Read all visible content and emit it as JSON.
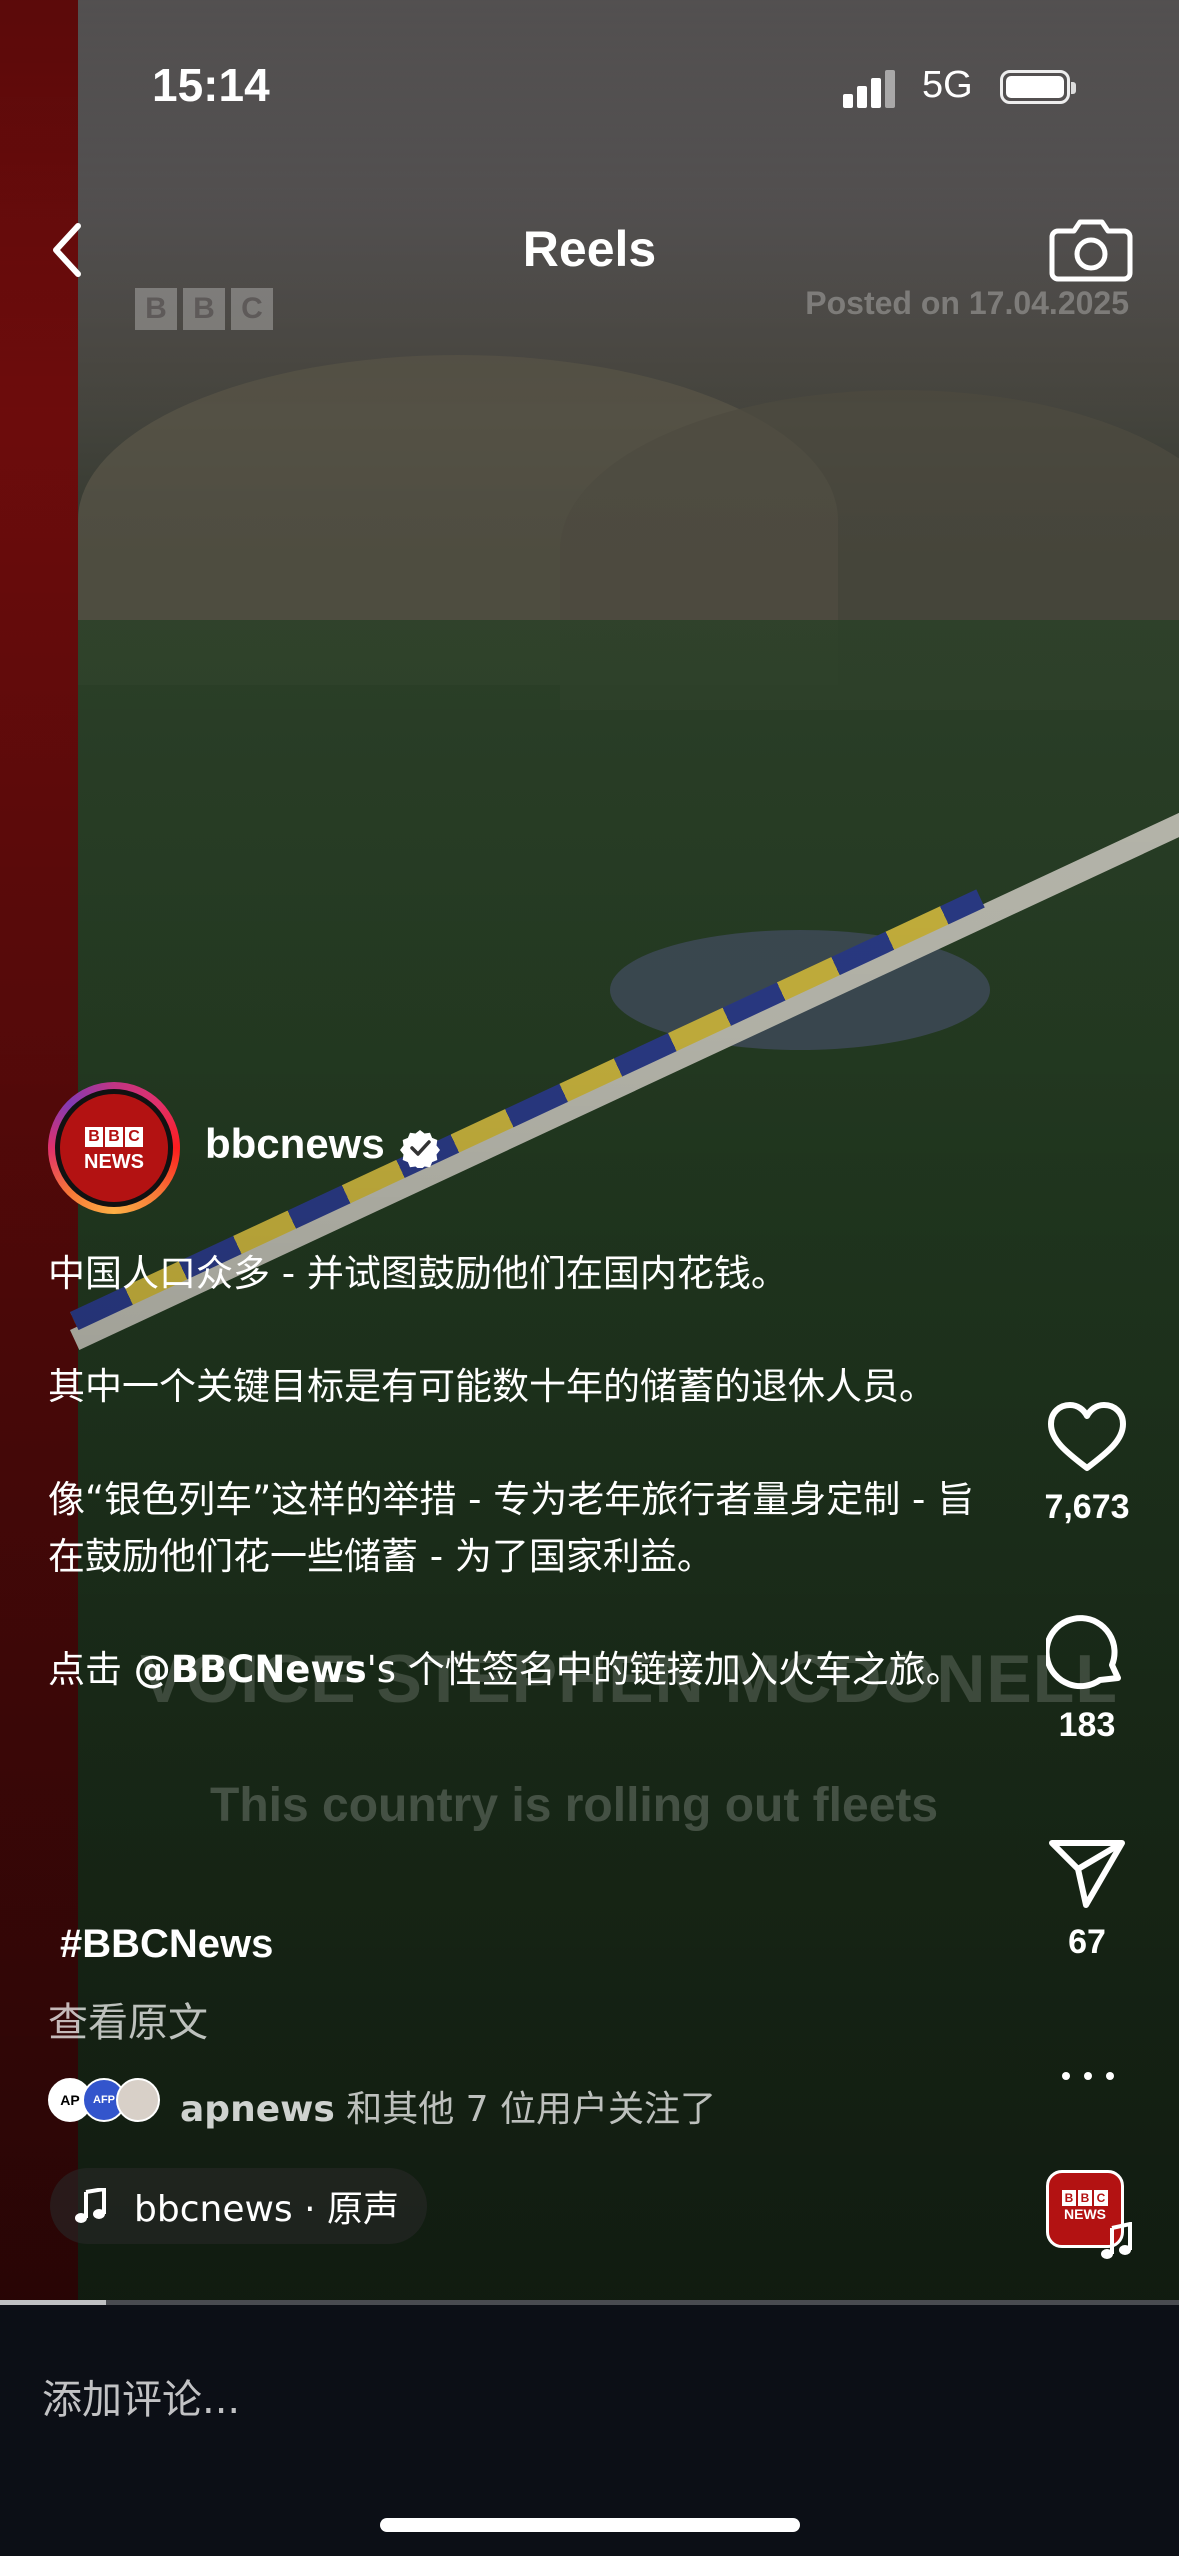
{
  "status_bar": {
    "time": "15:14",
    "network": "5G"
  },
  "nav": {
    "title": "Reels"
  },
  "video_overlay": {
    "watermark_brand": [
      "B",
      "B",
      "C"
    ],
    "posted_text": "Posted on 17.04.2025",
    "lower_third_name": "VOICE  STEPHEN MCDONELL",
    "lower_third_subtitle": "This country is rolling out fleets"
  },
  "author": {
    "username": "bbcnews",
    "avatar_logo_text": [
      "B",
      "B",
      "C"
    ],
    "avatar_logo_sub": "NEWS"
  },
  "caption": {
    "p1": "中国人口众多 - 并试图鼓励他们在国内花钱。",
    "p2": "其中一个关键目标是有可能数十年的储蓄的退休人员。",
    "p3": "像“银色列车”这样的举措 - 专为老年旅行者量身定制 - 旨在鼓励他们花一些储蓄 - 为了国家利益。",
    "p4_prefix": "点击 ",
    "p4_mention": "@BBCNews",
    "p4_suffix": "'s 个性签名中的链接加入火车之旅。",
    "hashtag": "#BBCNews",
    "see_original": "查看原文"
  },
  "followers": {
    "avatars": [
      "AP",
      "AFP",
      ""
    ],
    "lead_name": "apnews",
    "rest_text": " 和其他 7 位用户关注了"
  },
  "audio": {
    "label": "bbcnews · 原声"
  },
  "actions": {
    "likes": "7,673",
    "comments": "183",
    "shares": "67"
  },
  "progress": {
    "fraction": 0.09
  },
  "comment_bar": {
    "placeholder": "添加评论..."
  },
  "colors": {
    "brand_red": "#b31212",
    "background": "#0c0f16",
    "text": "#ffffff"
  },
  "icons": [
    "back-icon",
    "camera-icon",
    "verified-icon",
    "heart-icon",
    "comment-icon",
    "share-icon",
    "more-icon",
    "music-note-icon",
    "signal-icon",
    "battery-icon"
  ]
}
